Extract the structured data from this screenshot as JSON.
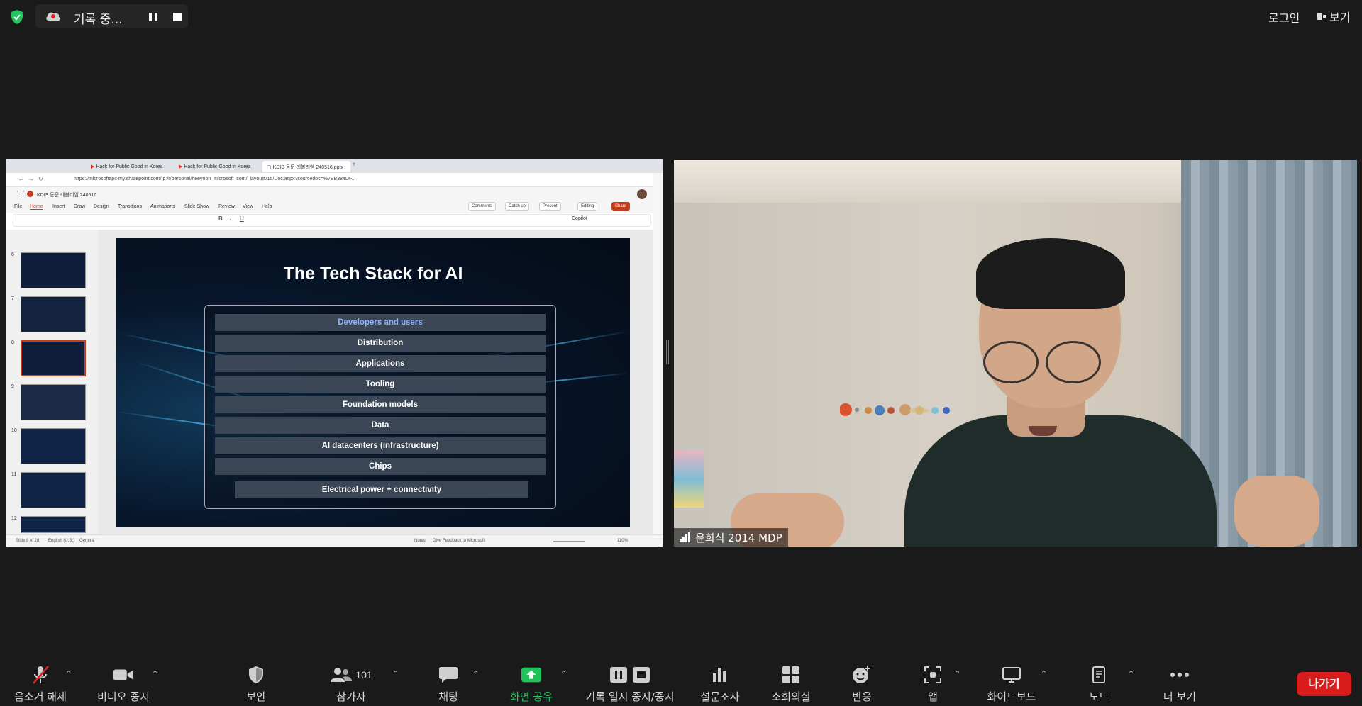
{
  "top_bar": {
    "recording_status": "기록 중...",
    "login_label": "로그인",
    "view_label": "보기"
  },
  "shared_screen": {
    "browser_tabs": [
      "Hack for Public Good in Korea",
      "Hack for Public Good in Korea",
      "KDIS 동문 레볼리엠 240516.pptx"
    ],
    "url": "https://microsoftapc-my.sharepoint.com/:p:/r/personal/heeyoon_microsoft_com/_layouts/15/Doc.aspx?sourcedoc=%7BB384DF...",
    "doc_name": "KDIS 동문 레볼리엠 240516",
    "ribbon_tabs": [
      "File",
      "Home",
      "Insert",
      "Draw",
      "Design",
      "Transitions",
      "Animations",
      "Slide Show",
      "Review",
      "View",
      "Help"
    ],
    "active_tab": "Home",
    "ribbon_buttons": {
      "comments": "Comments",
      "catchup": "Catch up",
      "present": "Present",
      "editing": "Editing",
      "share": "Share",
      "copilot": "Copilot"
    },
    "thumbnail_numbers": [
      "6",
      "7",
      "8",
      "9",
      "10",
      "11",
      "12"
    ],
    "slide": {
      "title": "The Tech Stack for AI",
      "layers": [
        "Developers and users",
        "Distribution",
        "Applications",
        "Tooling",
        "Foundation models",
        "Data",
        "AI datacenters (infrastructure)",
        "Chips",
        "Electrical power + connectivity"
      ]
    },
    "status_bar": {
      "slide_count": "Slide 8 of 28",
      "language": "English (U.S.)",
      "sensitivity": "General",
      "notes": "Notes",
      "feedback": "Give Feedback to Microsoft",
      "zoom": "110%"
    }
  },
  "video": {
    "participant_name": "윤희식 2014 MDP"
  },
  "toolbar": {
    "items": [
      {
        "label": "음소거 해제",
        "icon": "mic-muted-icon"
      },
      {
        "label": "비디오 중지",
        "icon": "video-camera-icon"
      },
      {
        "label": "보안",
        "icon": "shield-icon"
      },
      {
        "label": "참가자",
        "icon": "participants-icon",
        "count": "101"
      },
      {
        "label": "채팅",
        "icon": "chat-icon"
      },
      {
        "label": "화면 공유",
        "icon": "share-screen-icon"
      },
      {
        "label": "기록 일시 중지/중지",
        "icon": "pause-stop-icon"
      },
      {
        "label": "설문조사",
        "icon": "poll-icon"
      },
      {
        "label": "소회의실",
        "icon": "breakout-rooms-icon"
      },
      {
        "label": "반응",
        "icon": "reactions-icon"
      },
      {
        "label": "앱",
        "icon": "apps-icon"
      },
      {
        "label": "화이트보드",
        "icon": "whiteboard-icon"
      },
      {
        "label": "노트",
        "icon": "notes-icon"
      },
      {
        "label": "더 보기",
        "icon": "more-icon"
      }
    ],
    "leave_label": "나가기"
  },
  "colors": {
    "share_green": "#1fc35a",
    "leave_red": "#d91d1d",
    "shield_green": "#22c55e"
  }
}
